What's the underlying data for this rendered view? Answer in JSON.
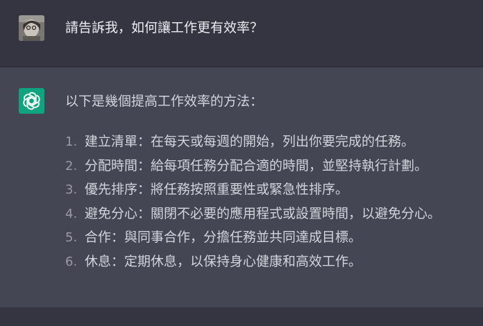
{
  "user_message": {
    "text": "請告訴我，如何讓工作更有效率？"
  },
  "assistant_message": {
    "intro": "以下是幾個提高工作效率的方法：",
    "items": [
      {
        "num": "1.",
        "text": "建立清單：在每天或每週的開始，列出你要完成的任務。"
      },
      {
        "num": "2.",
        "text": "分配時間：給每項任務分配合適的時間，並堅持執行計劃。"
      },
      {
        "num": "3.",
        "text": "優先排序：將任務按照重要性或緊急性排序。"
      },
      {
        "num": "4.",
        "text": "避免分心：關閉不必要的應用程式或設置時間，以避免分心。"
      },
      {
        "num": "5.",
        "text": "合作：與同事合作，分擔任務並共同達成目標。"
      },
      {
        "num": "6.",
        "text": "休息：定期休息，以保持身心健康和高效工作。"
      }
    ]
  },
  "colors": {
    "user_bg": "#343541",
    "assistant_bg": "#444654",
    "brand_green": "#10a37f"
  },
  "icons": {
    "user_avatar": "user-avatar-photo",
    "assistant_avatar": "openai-logo-icon"
  }
}
